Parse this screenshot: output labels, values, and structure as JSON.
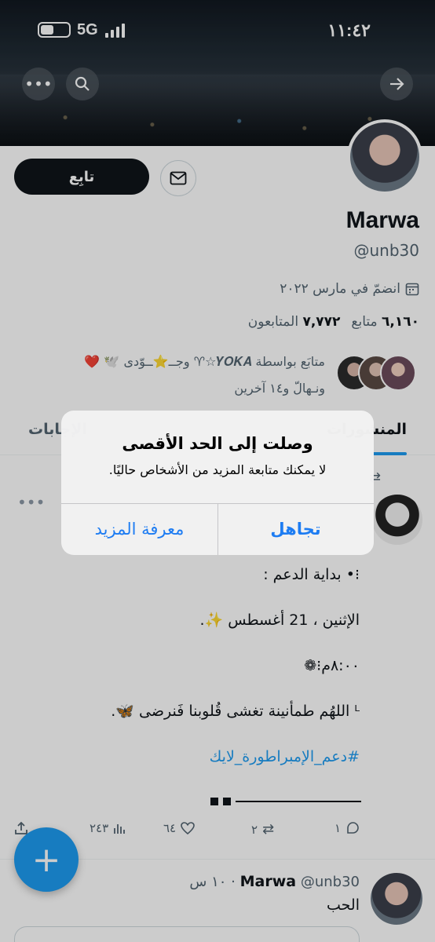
{
  "status_bar": {
    "network": "5G",
    "time": "١١:٤٢"
  },
  "profile": {
    "name": "Marwa",
    "handle": "@unb30",
    "joined": "انضمّ في مارس ٢٠٢٢",
    "following_count": "٦,١٦٠",
    "following_label": "متابع",
    "followers_count": "٧,٧٧٢",
    "followers_label": "المتابعون",
    "followed_by_line1": "متابَع بواسطة 𝒀𝑶𝑲𝑨☆♈ وجــ⭐ــوّدى 🕊️ ❤️",
    "followed_by_line2": "ونـهالّ و١٤ آخرين",
    "follow_button": "تابِع"
  },
  "tabs": {
    "active": "المنشورات",
    "other": "الإجابات"
  },
  "alert": {
    "title": "وصلت إلى الحد الأقصى",
    "message": "لا يمكنك متابعة المزيد من الأشخاص حاليًا.",
    "primary_button": "تجاهل",
    "secondary_button": "معرفة المزيد"
  },
  "tweet": {
    "line1": "⁝• بداية الدعم :",
    "line2": "الإثنين ، 21 أغسطس ✨.",
    "line3": "٨:٠٠م⁝❁",
    "line4": "ᴸ اللهُم طمأنينة تغشى قُلوبنا فَنرضى 🦋.",
    "hashtag": "#دعم_الإمبراطورة_لايك",
    "reply_count": "١",
    "retweet_count": "٢",
    "like_count": "٦٤",
    "views_count": "٢٤٣"
  },
  "tweet2": {
    "name": "Marwa",
    "meta": "@unb30 · ١٠ س",
    "text": "الحب"
  },
  "colors": {
    "accent": "#1d9bf0",
    "text": "#0f1419",
    "muted": "#536471"
  }
}
